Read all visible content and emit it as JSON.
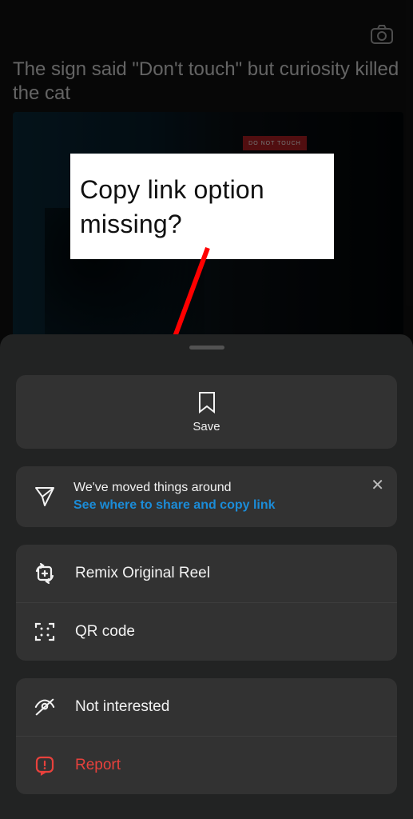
{
  "post": {
    "caption": "The sign said \"Don't touch\" but curiosity killed the cat",
    "sign_text": "DO NOT TOUCH"
  },
  "annotation": {
    "text": "Copy link option missing?"
  },
  "sheet": {
    "save_label": "Save",
    "info": {
      "primary": "We've moved things around",
      "link": "See where to share and copy link"
    },
    "actions": {
      "remix": "Remix Original Reel",
      "qr": "QR code",
      "not_interested": "Not interested",
      "report": "Report"
    }
  },
  "icons": {
    "camera": "camera-icon",
    "bookmark": "bookmark-icon",
    "send": "send-icon",
    "remix": "remix-icon",
    "qr": "qr-code-icon",
    "eye_off": "eye-off-icon",
    "report": "report-icon",
    "close": "close-icon"
  }
}
